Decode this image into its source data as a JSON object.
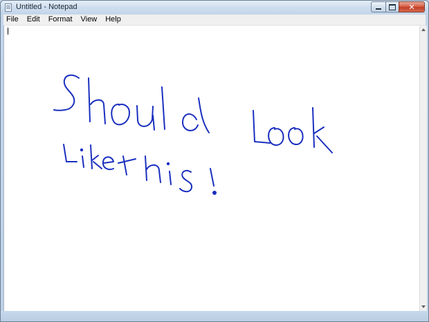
{
  "window": {
    "title": "Untitled - Notepad"
  },
  "caption_buttons": {
    "minimize": "minimize",
    "maximize": "maximize",
    "close": "close"
  },
  "menu": {
    "items": [
      "File",
      "Edit",
      "Format",
      "View",
      "Help"
    ]
  },
  "document": {
    "text": ""
  },
  "handwriting": {
    "line1": "Should Look",
    "line2": "Like this!",
    "ink_color": "#1a2fbf"
  }
}
